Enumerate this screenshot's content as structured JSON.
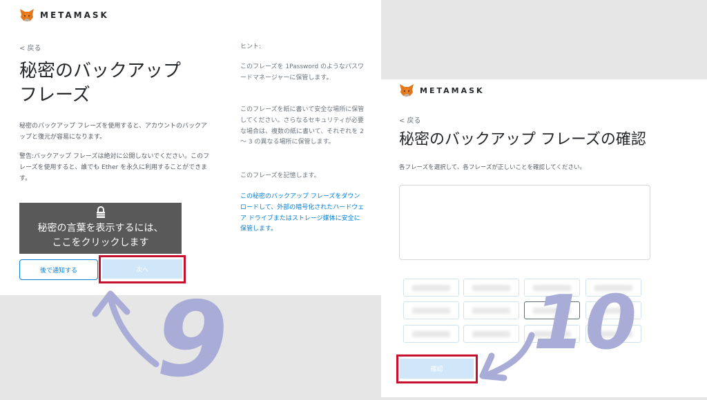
{
  "left": {
    "brand": "METAMASK",
    "back": "< 戻る",
    "title_line1": "秘密のバックアップ",
    "title_line2": "フレーズ",
    "desc": "秘密のバックアップ フレーズを使用すると、アカウントのバックアップと復元が容易になります。",
    "warning": "警告:バックアップ フレーズは絶対に公開しないでください。このフレーズを使用すると、誰でも Ether を永久に利用することができます。",
    "reveal_line1": "秘密の言葉を表示するには、",
    "reveal_line2": "ここをクリックします",
    "remind_later": "後で通知する",
    "next": "次へ",
    "hint_title": "ヒント:",
    "hint1": "このフレーズを 1Password のようなパスワードマネージャーに保管します。",
    "hint2": "このフレーズを紙に書いて安全な場所に保管してください。さらなるセキュリティが必要な場合は、複数の紙に書いて、それぞれを 2 ～ 3 の異なる場所に保管します。",
    "hint3": "このフレーズを記憶します。",
    "hint_link": "この秘密のバックアップ フレーズをダウンロードして、外部の暗号化されたハードウェア ドライブまたはストレージ媒体に安全に保管します。"
  },
  "right": {
    "brand": "METAMASK",
    "back": "< 戻る",
    "title": "秘密のバックアップ フレーズの確認",
    "instruction": "各フレーズを選択して、各フレーズが正しいことを確認してください。",
    "confirm": "確認"
  },
  "annotations": {
    "step_left": "9",
    "step_right": "10"
  },
  "colors": {
    "accent": "#037dd6",
    "highlight": "#c8102e",
    "annotation": "#a9acd6",
    "reveal_bg": "#595959"
  }
}
